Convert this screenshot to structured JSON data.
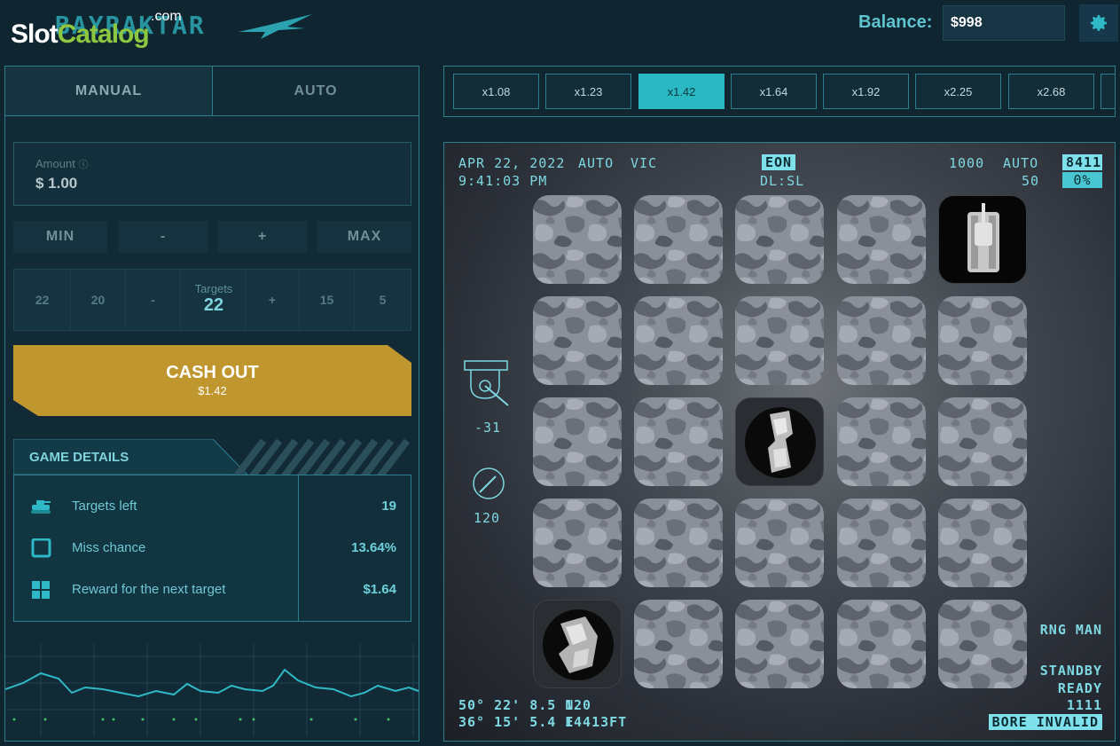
{
  "header": {
    "watermark": {
      "brand": "Slot",
      "brand_accent": "Catalog",
      "suffix": ".com"
    },
    "game_name": "BAYRAKTAR",
    "balance_label": "Balance:",
    "balance_value": "$998",
    "settings_icon": "gear-icon"
  },
  "tabs": [
    {
      "label": "MANUAL",
      "active": true
    },
    {
      "label": "AUTO",
      "active": false
    }
  ],
  "amount": {
    "label": "Amount",
    "info_icon": "info-icon",
    "value": "$ 1.00"
  },
  "stake_buttons": [
    "MIN",
    "-",
    "+",
    "MAX"
  ],
  "targets": {
    "label": "Targets",
    "value": "22",
    "left_options": [
      "22",
      "20",
      "-"
    ],
    "right_options": [
      "+",
      "15",
      "5"
    ]
  },
  "cashout": {
    "label": "CASH OUT",
    "amount": "$1.42"
  },
  "game_details": {
    "title": "GAME DETAILS",
    "rows": [
      {
        "icon": "tank-icon",
        "label": "Targets left",
        "value": "19"
      },
      {
        "icon": "square-icon",
        "label": "Miss chance",
        "value": "13.64%"
      },
      {
        "icon": "grid-icon",
        "label": "Reward for the next target",
        "value": "$1.64"
      }
    ]
  },
  "multipliers": {
    "items": [
      "x1.08",
      "x1.23",
      "x1.42",
      "x1.64",
      "x1.92",
      "x2.25",
      "x2.68"
    ],
    "active_index": 2
  },
  "hud": {
    "date": "APR 22, 2022",
    "time": "9:41:03 PM",
    "mode": "AUTO",
    "mode2": "VIC",
    "center_box": "EON",
    "center_sub": "DL:SL",
    "right_num1": "1000",
    "right_num2": "50",
    "right_mode": "AUTO",
    "right_box1": "8411",
    "right_box2": "0%",
    "gauge1_value": "-31",
    "gauge2_value": "120",
    "lat": "50° 22' 8.5 N",
    "lon": "36° 15' 5.4 E",
    "lat_extra": "120",
    "altitude": "14413FT",
    "status_rng": "RNG MAN",
    "status_standby": "STANDBY",
    "status_ready": "READY",
    "status_code": "1111",
    "status_bore": "BORE INVALID"
  },
  "grid": {
    "rows": 5,
    "cols": 5,
    "revealed": [
      {
        "row": 0,
        "col": 4,
        "kind": "tank-target"
      },
      {
        "row": 2,
        "col": 2,
        "kind": "wreck-target"
      },
      {
        "row": 4,
        "col": 0,
        "kind": "wreck-target"
      }
    ]
  },
  "colors": {
    "accent": "#2ab8c2",
    "cashout": "#c0962f",
    "panel_border": "#2e7e8c"
  }
}
